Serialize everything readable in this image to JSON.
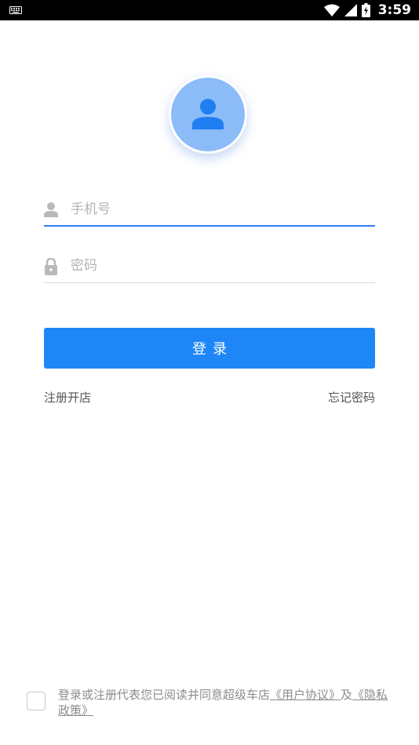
{
  "status_bar": {
    "time": "3:59",
    "icons": [
      "keyboard-icon",
      "wifi-icon",
      "signal-icon",
      "battery-icon"
    ]
  },
  "avatar": {
    "icon": "person-icon",
    "color": "#8bbcf7"
  },
  "login_form": {
    "phone_placeholder": "手机号",
    "phone_value": "",
    "phone_icon": "person-icon",
    "password_placeholder": "密码",
    "password_value": "",
    "password_icon": "lock-icon",
    "submit_label": "登录",
    "submit_color": "#1f86f8"
  },
  "links": {
    "register": "注册开店",
    "forgot_password": "忘记密码"
  },
  "agreement": {
    "prefix": "登录或注册代表您已阅读并同意超级车店",
    "user_agreement": "《用户协议》",
    "conjunction": "及",
    "privacy_policy": "《隐私政策》",
    "checked": false
  },
  "colors": {
    "accent": "#1f86f8",
    "active_underline": "#2d7ff9",
    "status_bar": "#000000"
  }
}
